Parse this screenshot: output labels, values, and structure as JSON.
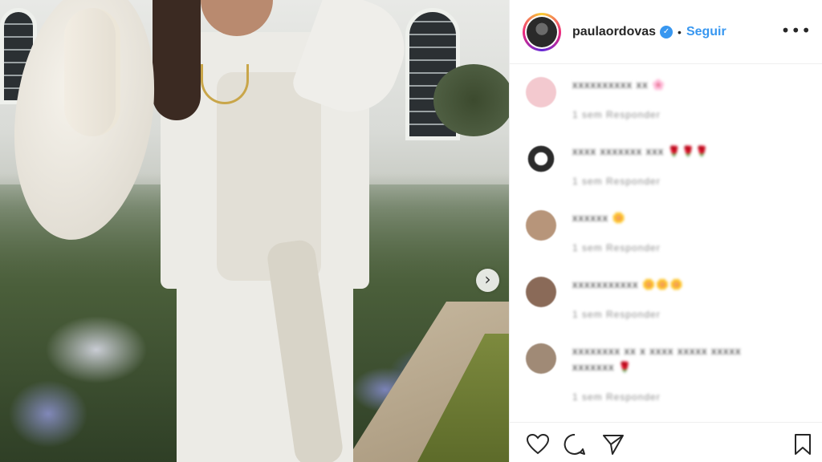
{
  "post": {
    "username": "paulaordovas",
    "follow_label": "Seguir",
    "separator": "•",
    "more_label": "•••",
    "next_label": "›"
  },
  "comments": [
    {
      "text": "xxxxxxxxxx xx",
      "emoji": "🌸",
      "meta": "1 sem   Responder",
      "avatar_color": "#f3c9cf"
    },
    {
      "text": "xxxx xxxxxxx xxx",
      "emoji": "🌹🌹🌹",
      "meta": "1 sem   Responder",
      "avatar_color": "#2b2b2b"
    },
    {
      "text": "xxxxxx",
      "emoji": "🌼",
      "meta": "1 sem   Responder",
      "avatar_color": "#b7957a"
    },
    {
      "text": "xxxxxxxxxxx",
      "emoji": "🌼🌼🌼",
      "meta": "1 sem   Responder",
      "avatar_color": "#8a6a58"
    },
    {
      "text": "xxxxxxxx xx x xxxx xxxxx xxxxx",
      "text2": "xxxxxxx",
      "emoji": "🌹",
      "meta": "1 sem   Responder",
      "avatar_color": "#a08a76"
    }
  ],
  "colors": {
    "link": "#3897f0",
    "text": "#262626",
    "muted": "#8e8e8e"
  },
  "icons": [
    "heart-icon",
    "comment-icon",
    "share-icon",
    "bookmark-icon",
    "verified-icon",
    "more-icon",
    "chevron-right-icon"
  ]
}
